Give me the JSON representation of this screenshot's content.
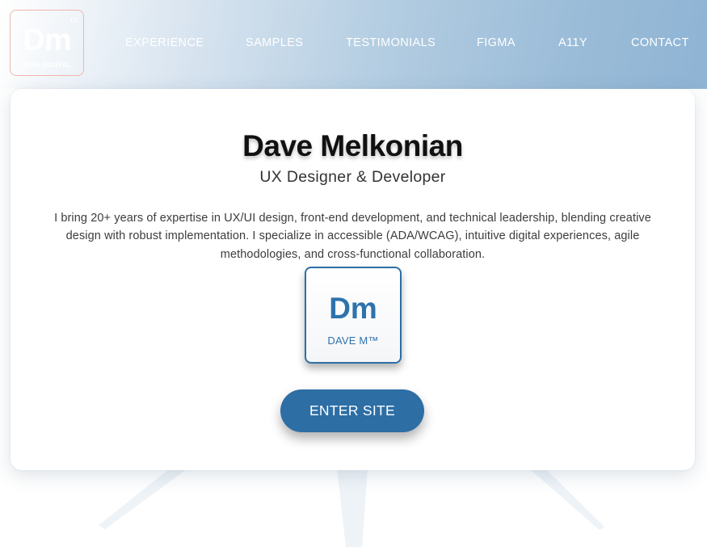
{
  "logo": {
    "corner_left": "UX",
    "corner_right": "UI",
    "mark": "Dm",
    "subtitle": "100% DIGITAL"
  },
  "nav": {
    "items": [
      {
        "label": "EXPERIENCE"
      },
      {
        "label": "SAMPLES"
      },
      {
        "label": "TESTIMONIALS"
      },
      {
        "label": "FIGMA"
      },
      {
        "label": "A11Y"
      },
      {
        "label": "CONTACT"
      }
    ]
  },
  "hero": {
    "name": "Dave Melkonian",
    "role": "UX Designer & Developer",
    "bio": "I bring 20+ years of expertise in UX/UI design, front-end development, and technical leadership, blending creative design with robust implementation. I specialize in accessible (ADA/WCAG), intuitive digital experiences, agile methodologies, and cross-functional collaboration.",
    "badge": {
      "mark": "Dm",
      "label": "DAVE M™"
    },
    "enter_label": "ENTER SITE"
  },
  "colors": {
    "accent": "#2d6ea5",
    "header_end": "#8fb4d4",
    "logo_border": "#f0aaa0"
  }
}
